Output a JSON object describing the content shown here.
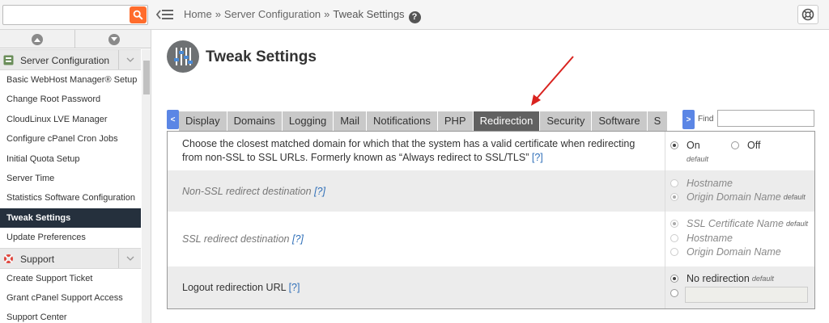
{
  "search": {
    "placeholder": "",
    "value": ""
  },
  "breadcrumb": {
    "home": "Home",
    "section": "Server Configuration",
    "current": "Tweak Settings",
    "sep": "»",
    "help": "?"
  },
  "sidebar": {
    "group1": "Server Configuration",
    "items1": [
      "Basic WebHost Manager® Setup",
      "Change Root Password",
      "CloudLinux LVE Manager",
      "Configure cPanel Cron Jobs",
      "Initial Quota Setup",
      "Server Time",
      "Statistics Software Configuration",
      "Tweak Settings",
      "Update Preferences"
    ],
    "active_index": 7,
    "group2": "Support",
    "items2": [
      "Create Support Ticket",
      "Grant cPanel Support Access",
      "Support Center"
    ]
  },
  "page": {
    "title": "Tweak Settings"
  },
  "tabs": {
    "scroll_left": "<",
    "scroll_right": ">",
    "items": [
      "Display",
      "Domains",
      "Logging",
      "Mail",
      "Notifications",
      "PHP",
      "Redirection",
      "Security",
      "Software",
      "S"
    ],
    "active_index": 6
  },
  "find": {
    "label": "Find",
    "value": ""
  },
  "settings": {
    "help_link": "[?]",
    "default_word": "default",
    "row1": {
      "label": "Choose the closest matched domain for which that the system has a valid certificate when redirecting from non-SSL to SSL URLs. Formerly known as “Always redirect to SSL/TLS”",
      "on": "On",
      "off": "Off"
    },
    "row2": {
      "label": "Non-SSL redirect destination",
      "opt1": "Hostname",
      "opt2": "Origin Domain Name"
    },
    "row3": {
      "label": "SSL redirect destination",
      "opt1": "SSL Certificate Name",
      "opt2": "Hostname",
      "opt3": "Origin Domain Name"
    },
    "row4": {
      "label": "Logout redirection URL",
      "opt1": "No redirection",
      "url_value": ""
    }
  },
  "colors": {
    "active_tab": "#616161",
    "sidebar_active": "#25303d",
    "search_button": "#ff6c2c",
    "annotation_arrow": "#d9231f"
  }
}
